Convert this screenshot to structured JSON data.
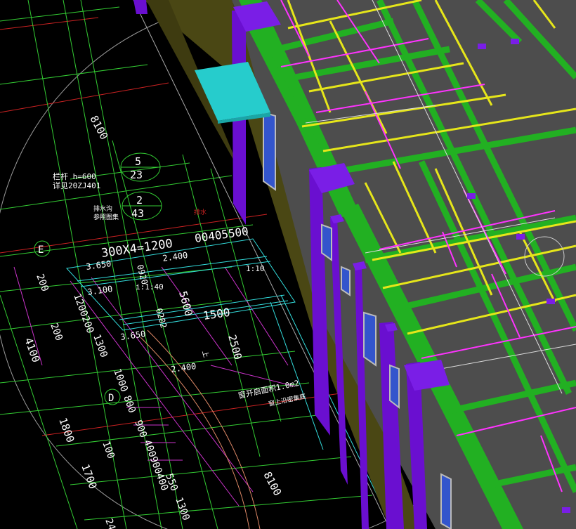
{
  "viewport": {
    "name": "CAD 3D model viewport",
    "colors": {
      "background": "#000000",
      "wall": "#4a4714",
      "column": "#6a0fd0",
      "beam": "#22b022",
      "slab": "#4d4d4d",
      "pipe_yellow": "#e6e61a",
      "pipe_magenta": "#ff33ff",
      "canopy": "#26cccc",
      "grid_green": "#33cc33",
      "grid_red": "#cc2222",
      "dim_cyan": "#33dddd",
      "dim_purple": "#cc33cc"
    }
  },
  "drawing_labels": {
    "dim_8100_top": "8100",
    "dim_8100_bottom": "8100",
    "railing_label": "栏杆 h=600",
    "detail_ref_label": "详见20ZJ401",
    "detail_5_top": "5",
    "detail_5_bottom": "23",
    "drain_label_1": "排水沟",
    "drain_label_2": "参照图集",
    "detail_2_top": "2",
    "detail_2_bottom": "43",
    "red_note": "排水",
    "axis_e": "E",
    "axis_d": "D",
    "stair_text": "300X4=1200",
    "stair_right": "00405500",
    "elev_3650_a": "3.650",
    "elev_2400_a": "2.400",
    "elev_3100": "3.100",
    "elev_3650_b": "3.650",
    "elev_2400_b": "2.400",
    "slope_ratio": "1:10",
    "dim_0920": "0920",
    "dim_i140": "i:1:40",
    "dim_5600": "5600",
    "dim_1500": "1500",
    "dim_2500": "2500",
    "dim_200_a": "200",
    "dim_1200200": "1200200",
    "dim_200_b": "200",
    "dim_4100": "4100",
    "dim_1300_a": "1300",
    "dim_1000": "1000",
    "dim_800": "800",
    "dim_1800": "1800",
    "dim_900": "900",
    "dim_100": "100",
    "dim_400900400": "400900400",
    "dim_550": "550",
    "dim_1700": "1700",
    "dim_1300_b": "1300",
    "dim_24": "24",
    "window_note_1": "窗开启面积1.0m2",
    "window_note_2": "窗上沿密集底",
    "stair_up": "上",
    "dim_0202": "0202"
  }
}
